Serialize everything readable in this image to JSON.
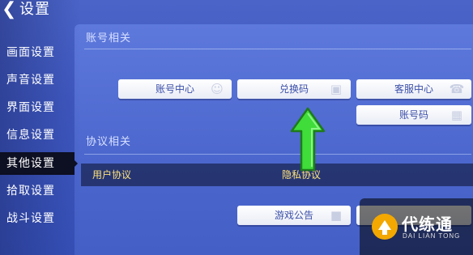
{
  "header": {
    "back_icon": "back-chevron-icon",
    "title": "设置"
  },
  "sidebar": {
    "items": [
      {
        "label": "画面设置",
        "active": false
      },
      {
        "label": "声音设置",
        "active": false
      },
      {
        "label": "界面设置",
        "active": false
      },
      {
        "label": "信息设置",
        "active": false
      },
      {
        "label": "其他设置",
        "active": true
      },
      {
        "label": "拾取设置",
        "active": false
      },
      {
        "label": "战斗设置",
        "active": false
      }
    ]
  },
  "main": {
    "account_section": {
      "title": "账号相关",
      "buttons": [
        "账号中心",
        "兑换码",
        "客服中心",
        "账号码"
      ]
    },
    "protocol_section": {
      "title": "协议相关",
      "links": [
        "用户协议",
        "隐私协议"
      ]
    },
    "bottom_buttons": [
      "游戏公告"
    ]
  },
  "overlay": {
    "arrow_color": "#3fdc3a",
    "arrow_direction": "up"
  },
  "watermark": {
    "name": "代练通",
    "subtitle": "DAI LIAN TONG",
    "logo_color": "#f2a800"
  }
}
